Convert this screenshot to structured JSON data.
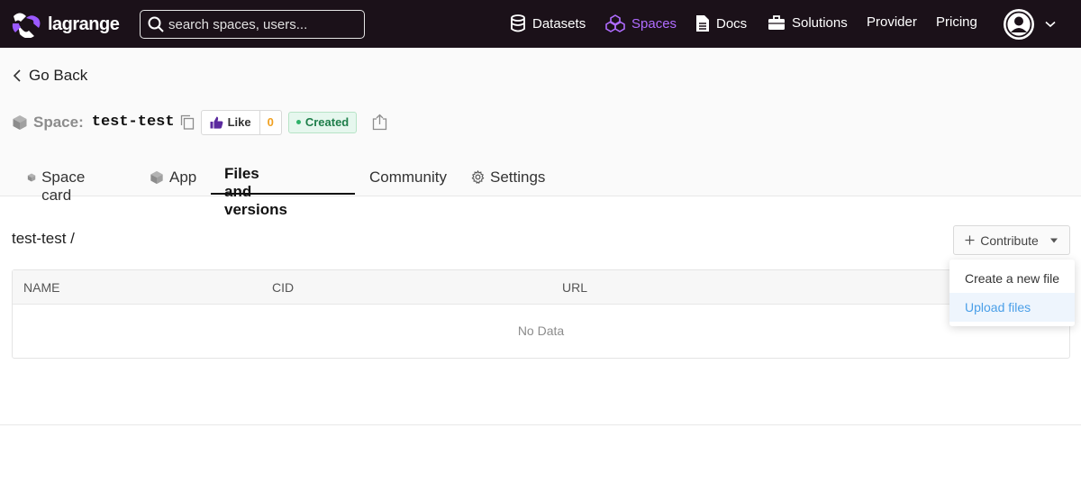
{
  "navbar": {
    "logo_text": "lagrange",
    "search_placeholder": "search spaces, users...",
    "items": [
      {
        "label": "Datasets",
        "icon": "database-icon"
      },
      {
        "label": "Spaces",
        "icon": "cubes-icon",
        "active": true
      },
      {
        "label": "Docs",
        "icon": "document-icon"
      },
      {
        "label": "Solutions",
        "icon": "briefcase-icon"
      },
      {
        "label": "Provider"
      },
      {
        "label": "Pricing"
      }
    ],
    "accent_color": "#b06cff",
    "background": "#1b1119"
  },
  "header": {
    "go_back": "Go Back",
    "space_label": "Space:",
    "space_name": "test-test",
    "like_label": "Like",
    "like_count": "0",
    "status": "Created",
    "status_color": "#1e7e4a"
  },
  "tabs": [
    {
      "label": "Space card",
      "icon": "cube-icon"
    },
    {
      "label": "App",
      "icon": "cube-icon"
    },
    {
      "label": "Files and versions",
      "active": true
    },
    {
      "label": "Community"
    },
    {
      "label": "Settings",
      "icon": "gear-icon"
    }
  ],
  "content": {
    "breadcrumb": "test-test /",
    "contribute_label": "Contribute",
    "table": {
      "columns": [
        "NAME",
        "CID",
        "URL"
      ],
      "empty_text": "No Data"
    },
    "dropdown": {
      "items": [
        {
          "label": "Create a new file"
        },
        {
          "label": "Upload files",
          "highlighted": true
        }
      ]
    }
  }
}
